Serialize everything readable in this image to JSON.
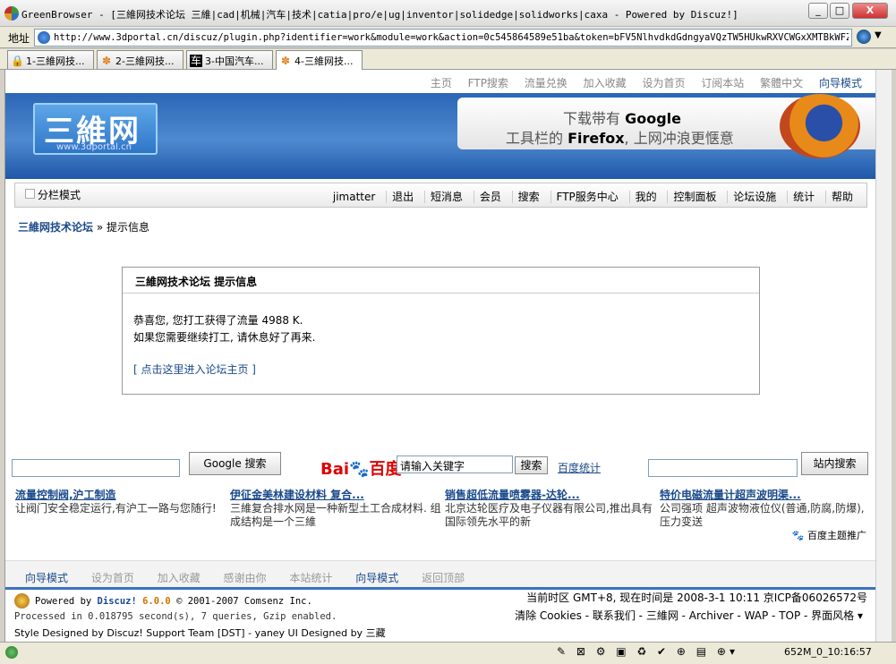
{
  "window": {
    "title": "GreenBrowser - [三維网技术论坛 三維|cad|机械|汽车|技术|catia|pro/e|ug|inventor|solidedge|solidworks|caxa - Powered by Discuz!]",
    "min_label": "_",
    "max_label": "□",
    "close_label": "X"
  },
  "address": {
    "label": "地址",
    "url": "http://www.3dportal.cn/discuz/plugin.php?identifier=work&module=work&action=0c545864589e51ba&token=bFV5NlhvdkdGdngyaVQzTW5HUkwRXVCWGxXMTBkWFZSZWd"
  },
  "tabs": [
    {
      "label": "1-三維网技...",
      "icon": "🔒"
    },
    {
      "label": "2-三維网技...",
      "icon": "✽"
    },
    {
      "label": "3-中国汽车...",
      "icon": "车"
    },
    {
      "label": "4-三維网技...",
      "icon": "✽"
    }
  ],
  "topnav": [
    "主页",
    "FTP搜索",
    "流量兑换",
    "加入收藏",
    "设为首页",
    "订阅本站",
    "繁體中文",
    "向导模式"
  ],
  "logo": {
    "title": "三維网",
    "sub": "www.3dportal.cn"
  },
  "firefox_ad": {
    "line1_pre": "下载带有 ",
    "line1_brand": "Google",
    "line2_pre": "工具栏的 ",
    "line2_brand": "Firefox",
    "line2_post": ", 上网冲浪更惬意"
  },
  "menubar": {
    "split_label": "分栏模式",
    "items": [
      "jimatter",
      "退出",
      "短消息",
      "会员",
      "搜索",
      "FTP服务中心",
      "我的",
      "控制面板",
      "论坛设施",
      "统计",
      "帮助"
    ]
  },
  "breadcrumb": {
    "home": "三維网技术论坛",
    "sep": "»",
    "current": "提示信息"
  },
  "message": {
    "title": "三維网技术论坛  提示信息",
    "line1": "恭喜您, 您打工获得了流量  4988 K.",
    "line2": "如果您需要继续打工, 请休息好了再来.",
    "link": "[ 点击这里进入论坛主页 ]"
  },
  "search": {
    "google_button": "Google 搜索",
    "baidu_value": "请输入关键字",
    "baidu_button": "搜索",
    "baidu_stats": "百度统计",
    "site_button": "站内搜索"
  },
  "ads": [
    {
      "title": "流量控制阀,沪工制造",
      "body": "让阀门安全稳定运行,有沪工一路与您随行!"
    },
    {
      "title": "伊征金美林建设材料 复合...",
      "body": "三維复合排水网是一种新型土工合成材料. 组成结构是一个三維"
    },
    {
      "title": "销售超低流量喷雾器-达轮...",
      "body": "北京达轮医疗及电子仪器有限公司,推出具有国际领先水平的新"
    },
    {
      "title": "特价电磁流量计超声波明渠...",
      "body": "公司强项 超声波物液位仪(普通,防腐,防爆), 压力变送"
    }
  ],
  "promo": "百度主题推广",
  "footnav": [
    "向导模式",
    "设为首页",
    "加入收藏",
    "感谢由你",
    "本站统计",
    "向导模式",
    "返回顶部"
  ],
  "footer": {
    "powered_pre": "Powered by ",
    "discuz": "Discuz!",
    "version": "6.0.0",
    "copyright": " © 2001-2007 Comsenz Inc.",
    "processed": "Processed in 0.018795 second(s), 7 queries, Gzip enabled.",
    "style": "Style Designed by Discuz! Support Team [DST] - yaney UI Designed by 三藏",
    "timezone": "当前时区  GMT+8, 现在时间是  2008-3-1 10:11 京ICP备06026572号",
    "links": "清除  Cookies - 联系我们 - 三維网 - Archiver - WAP - TOP - 界面风格 ▾"
  },
  "status": {
    "time": "652M_0_10:16:57"
  }
}
